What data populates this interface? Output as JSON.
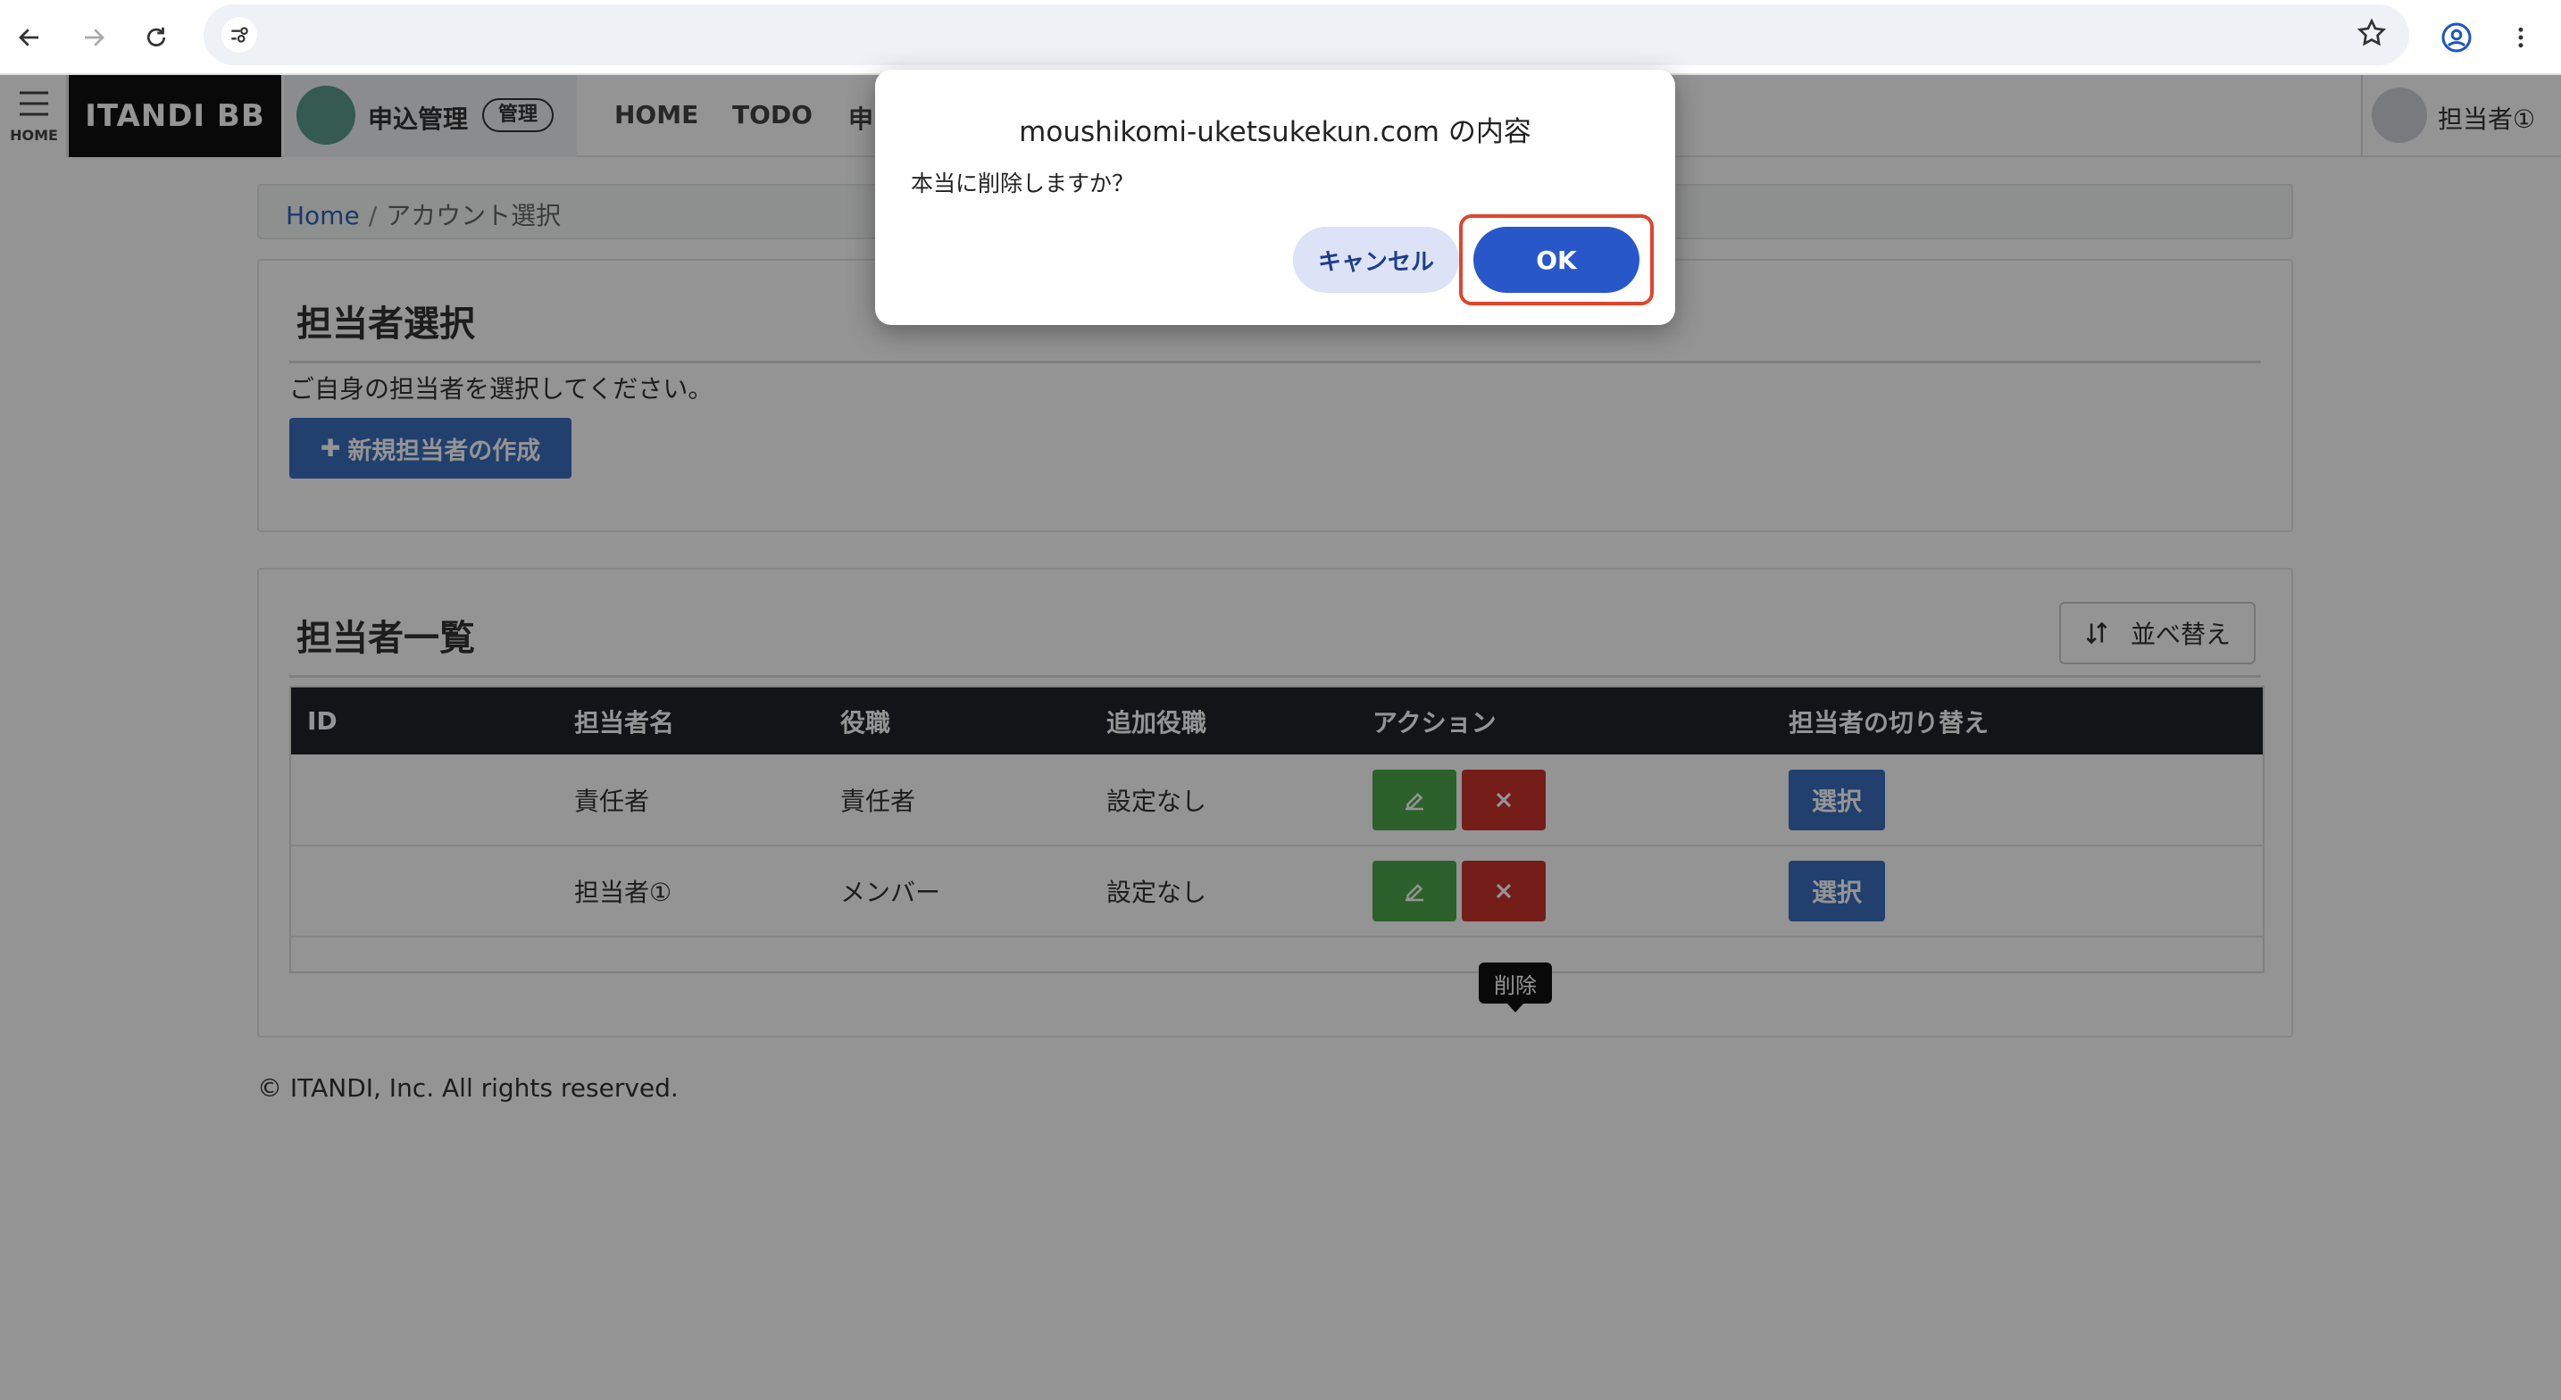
{
  "browser": {
    "icons": [
      "back-arrow-icon",
      "forward-arrow-icon",
      "reload-icon",
      "site-settings-icon",
      "star-icon",
      "profile-icon",
      "more-vert-icon"
    ],
    "url": ""
  },
  "appbar": {
    "menu_label": "HOME",
    "brand": "ITANDI BB",
    "service_name": "申込管理",
    "service_tag": "管理",
    "nav": [
      "HOME",
      "TODO",
      "申"
    ],
    "user_name": "担当者①"
  },
  "breadcrumb": {
    "home": "Home",
    "separator": "/",
    "current": "アカウント選択"
  },
  "select_panel": {
    "title": "担当者選択",
    "description": "ご自身の担当者を選択してください。",
    "new_button": "新規担当者の作成"
  },
  "list_panel": {
    "title": "担当者一覧",
    "sort_button": "並べ替え",
    "columns": [
      "ID",
      "担当者名",
      "役職",
      "追加役職",
      "アクション",
      "担当者の切り替え"
    ],
    "rows": [
      {
        "id": "",
        "name": "責任者",
        "role": "責任者",
        "extra_role": "設定なし",
        "select": "選択"
      },
      {
        "id": "",
        "name": "担当者①",
        "role": "メンバー",
        "extra_role": "設定なし",
        "select": "選択"
      }
    ],
    "tooltip": "削除"
  },
  "footer": "© ITANDI, Inc. All rights reserved.",
  "dialog": {
    "title": "moushikomi-uketsukekun.com の内容",
    "message": "本当に削除しますか？",
    "cancel": "キャンセル",
    "ok": "OK"
  },
  "colors": {
    "accent": "#2857c9",
    "primary_button": "#3a6ebe",
    "edit": "#4fa84a",
    "delete": "#c8332b",
    "highlight": "#e0452c"
  }
}
